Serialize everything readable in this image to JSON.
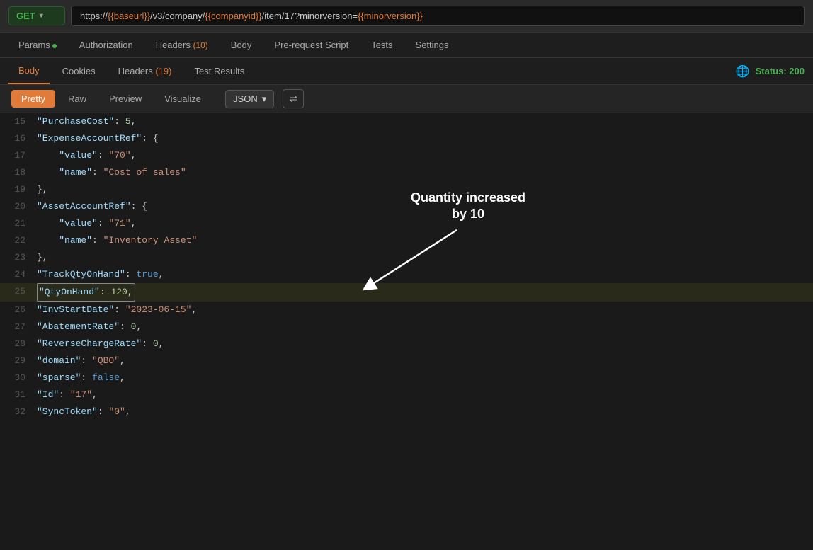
{
  "url_bar": {
    "method": "GET",
    "url_parts": [
      {
        "text": "https://",
        "type": "plain"
      },
      {
        "text": "{{baseurl}}",
        "type": "var"
      },
      {
        "text": "/v3/company/",
        "type": "plain"
      },
      {
        "text": "{{companyid}}",
        "type": "var"
      },
      {
        "text": "/item/17?minorversion=",
        "type": "plain"
      },
      {
        "text": "{{minorversion}}",
        "type": "var"
      }
    ]
  },
  "request_tabs": [
    {
      "label": "Params",
      "badge": "dot",
      "active": false
    },
    {
      "label": "Authorization",
      "active": false
    },
    {
      "label": "Headers",
      "badge": "(10)",
      "active": false
    },
    {
      "label": "Body",
      "active": false
    },
    {
      "label": "Pre-request Script",
      "active": false
    },
    {
      "label": "Tests",
      "active": false
    },
    {
      "label": "Settings",
      "active": false
    }
  ],
  "response_tabs": [
    {
      "label": "Body",
      "active": true
    },
    {
      "label": "Cookies",
      "active": false
    },
    {
      "label": "Headers",
      "badge": "(19)",
      "active": false
    },
    {
      "label": "Test Results",
      "active": false
    }
  ],
  "status": "Status: 200",
  "view_tabs": [
    {
      "label": "Pretty",
      "active": true
    },
    {
      "label": "Raw",
      "active": false
    },
    {
      "label": "Preview",
      "active": false
    },
    {
      "label": "Visualize",
      "active": false
    }
  ],
  "format": "JSON",
  "code_lines": [
    {
      "num": 15,
      "content": "    \"PurchaseCost\": 5,",
      "type": "normal"
    },
    {
      "num": 16,
      "content": "    \"ExpenseAccountRef\": {",
      "type": "normal"
    },
    {
      "num": 17,
      "content": "        \"value\": \"70\",",
      "type": "normal"
    },
    {
      "num": 18,
      "content": "        \"name\": \"Cost of sales\"",
      "type": "normal"
    },
    {
      "num": 19,
      "content": "    },",
      "type": "normal"
    },
    {
      "num": 20,
      "content": "    \"AssetAccountRef\": {",
      "type": "normal"
    },
    {
      "num": 21,
      "content": "        \"value\": \"71\",",
      "type": "normal"
    },
    {
      "num": 22,
      "content": "        \"name\": \"Inventory Asset\"",
      "type": "normal"
    },
    {
      "num": 23,
      "content": "    },",
      "type": "normal"
    },
    {
      "num": 24,
      "content": "    \"TrackQtyOnHand\": true,",
      "type": "normal"
    },
    {
      "num": 25,
      "content": "    \"QtyOnHand\": 120,",
      "type": "highlighted"
    },
    {
      "num": 26,
      "content": "    \"InvStartDate\": \"2023-06-15\",",
      "type": "normal"
    },
    {
      "num": 27,
      "content": "    \"AbatementRate\": 0,",
      "type": "normal"
    },
    {
      "num": 28,
      "content": "    \"ReverseChargeRate\": 0,",
      "type": "normal"
    },
    {
      "num": 29,
      "content": "    \"domain\": \"QBO\",",
      "type": "normal"
    },
    {
      "num": 30,
      "content": "    \"sparse\": false,",
      "type": "normal"
    },
    {
      "num": 31,
      "content": "    \"Id\": \"17\",",
      "type": "normal"
    },
    {
      "num": 32,
      "content": "    \"SyncToken\": \"0\",",
      "type": "normal"
    }
  ],
  "annotation": {
    "text": "Quantity increased\nby 10"
  }
}
